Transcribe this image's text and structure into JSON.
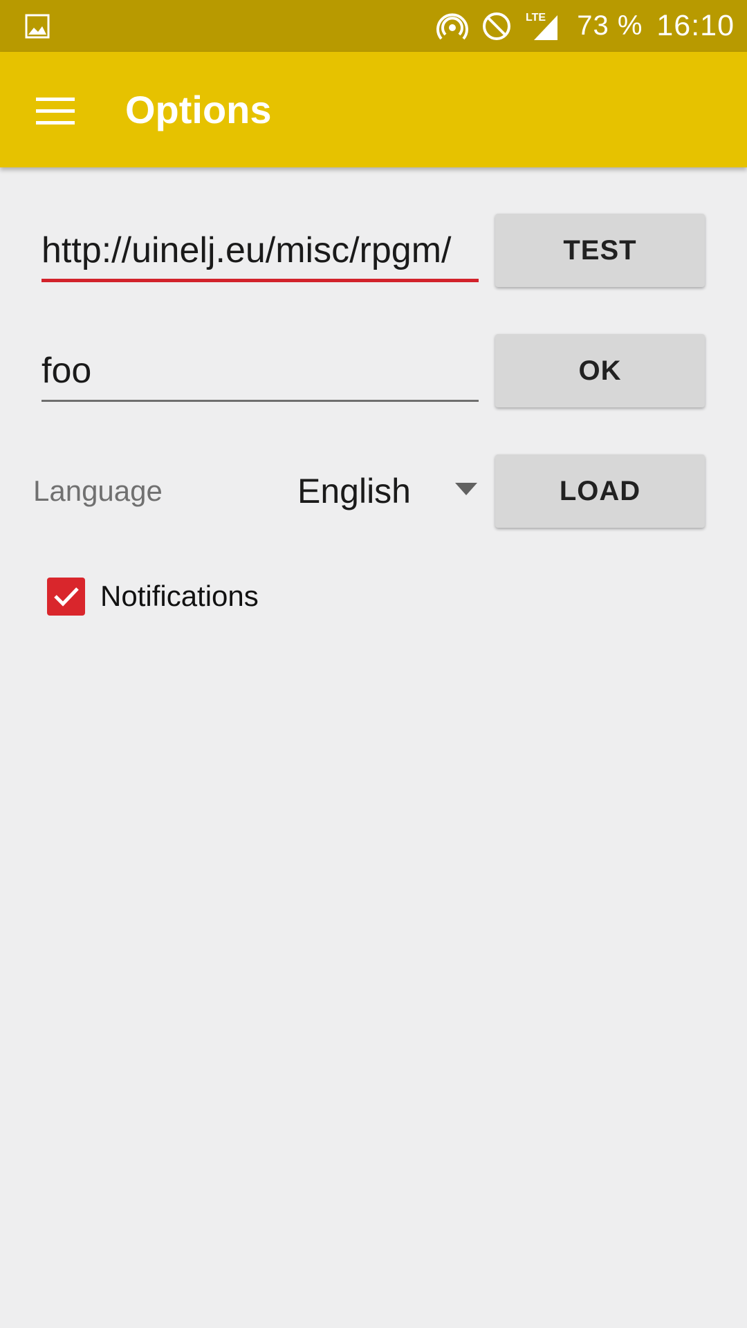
{
  "status_bar": {
    "battery": "73 %",
    "time": "16:10",
    "network": "LTE",
    "icons": [
      "gallery-icon",
      "hotspot-icon",
      "do-not-disturb-icon",
      "lte-signal-icon"
    ]
  },
  "app_bar": {
    "title": "Options",
    "menu_icon": "menu-icon",
    "color": "#e6c200"
  },
  "form": {
    "url_value": "http://uinelj.eu/misc/rpgm/",
    "name_value": "foo",
    "test_label": "TEST",
    "ok_label": "OK",
    "load_label": "LOAD",
    "language_label": "Language",
    "language_value": "English",
    "notifications_label": "Notifications",
    "notifications_checked": true
  },
  "colors": {
    "status_bar": "#b89a00",
    "accent": "#d9262c",
    "background": "#eeeeef"
  }
}
